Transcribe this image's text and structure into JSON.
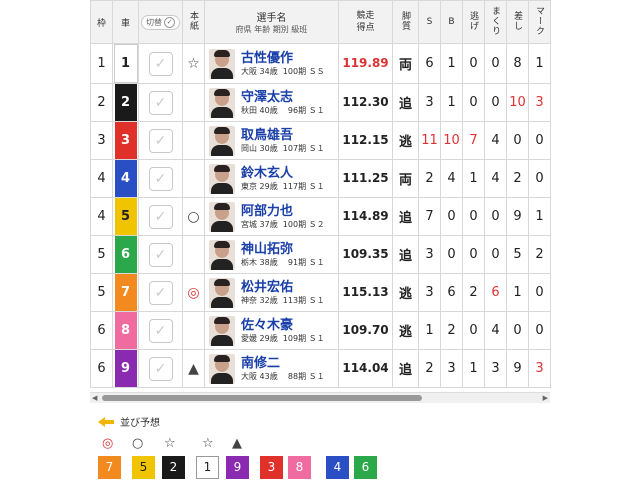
{
  "headers": {
    "waku": "枠",
    "car": "車",
    "toggle": "切替",
    "honshi": "本紙",
    "name_l1": "選手名",
    "name_l2": "府県 年齢 期別 級班",
    "score_l1": "競走",
    "score_l2": "得点",
    "kyakushitsu": "脚質",
    "s": "S",
    "b": "B",
    "nige": "逃げ",
    "makuri": "まくり",
    "sashi": "差し",
    "mark": "マーク"
  },
  "colors": {
    "car_1": "#ffffff",
    "car_2": "#1a1a1a",
    "car_3": "#e0302a",
    "car_4": "#2a4fc4",
    "car_5": "#f1c400",
    "car_6": "#2aa84a",
    "car_7": "#f28a1f",
    "car_8": "#f06ba0",
    "car_9": "#8a2ab0",
    "accent": "#d33"
  },
  "riders": [
    {
      "waku": "1",
      "car": "1",
      "mark": "☆",
      "name": "古性優作",
      "meta": "大阪 34歳  100期 ＳＳ",
      "score": "119.89",
      "kyaku": "両",
      "s": "6",
      "b": "1",
      "nige": "0",
      "makuri": "0",
      "sashi": "8",
      "mk": "1"
    },
    {
      "waku": "2",
      "car": "2",
      "mark": "",
      "name": "守澤太志",
      "meta": "秋田 40歳    96期 Ｓ１",
      "score": "112.30",
      "kyaku": "追",
      "s": "3",
      "b": "1",
      "nige": "0",
      "makuri": "0",
      "sashi": "10",
      "mk": "3"
    },
    {
      "waku": "3",
      "car": "3",
      "mark": "",
      "name": "取鳥雄吾",
      "meta": "岡山 30歳  107期 Ｓ１",
      "score": "112.15",
      "kyaku": "逃",
      "s": "11",
      "b": "10",
      "nige": "7",
      "makuri": "4",
      "sashi": "0",
      "mk": "0"
    },
    {
      "waku": "4",
      "car": "4",
      "mark": "",
      "name": "鈴木玄人",
      "meta": "東京 29歳  117期 Ｓ１",
      "score": "111.25",
      "kyaku": "両",
      "s": "2",
      "b": "4",
      "nige": "1",
      "makuri": "4",
      "sashi": "2",
      "mk": "0"
    },
    {
      "waku": "4",
      "car": "5",
      "mark": "○",
      "name": "阿部力也",
      "meta": "宮城 37歳  100期 Ｓ２",
      "score": "114.89",
      "kyaku": "追",
      "s": "7",
      "b": "0",
      "nige": "0",
      "makuri": "0",
      "sashi": "9",
      "mk": "1"
    },
    {
      "waku": "5",
      "car": "6",
      "mark": "",
      "name": "神山拓弥",
      "meta": "栃木 38歳    91期 Ｓ１",
      "score": "109.35",
      "kyaku": "追",
      "s": "3",
      "b": "0",
      "nige": "0",
      "makuri": "0",
      "sashi": "5",
      "mk": "2"
    },
    {
      "waku": "5",
      "car": "7",
      "mark": "◎",
      "name": "松井宏佑",
      "meta": "神奈 32歳  113期 Ｓ１",
      "score": "115.13",
      "kyaku": "逃",
      "s": "3",
      "b": "6",
      "nige": "2",
      "makuri": "6",
      "sashi": "1",
      "mk": "0"
    },
    {
      "waku": "6",
      "car": "8",
      "mark": "",
      "name": "佐々木豪",
      "meta": "愛媛 29歳  109期 Ｓ１",
      "score": "109.70",
      "kyaku": "逃",
      "s": "1",
      "b": "2",
      "nige": "0",
      "makuri": "4",
      "sashi": "0",
      "mk": "0"
    },
    {
      "waku": "6",
      "car": "9",
      "mark": "▲",
      "name": "南修二",
      "meta": "大阪 43歳    88期 Ｓ１",
      "score": "114.04",
      "kyaku": "追",
      "s": "2",
      "b": "3",
      "nige": "1",
      "makuri": "3",
      "sashi": "9",
      "mk": "3"
    }
  ],
  "checkbox_glyph": "✓",
  "prediction": {
    "title": "並び予想",
    "marks": [
      "◎",
      "○",
      "☆",
      "☆",
      "▲"
    ],
    "boxes": [
      "7",
      "5",
      "2",
      "1",
      "9",
      "3",
      "8",
      "4",
      "6"
    ]
  }
}
